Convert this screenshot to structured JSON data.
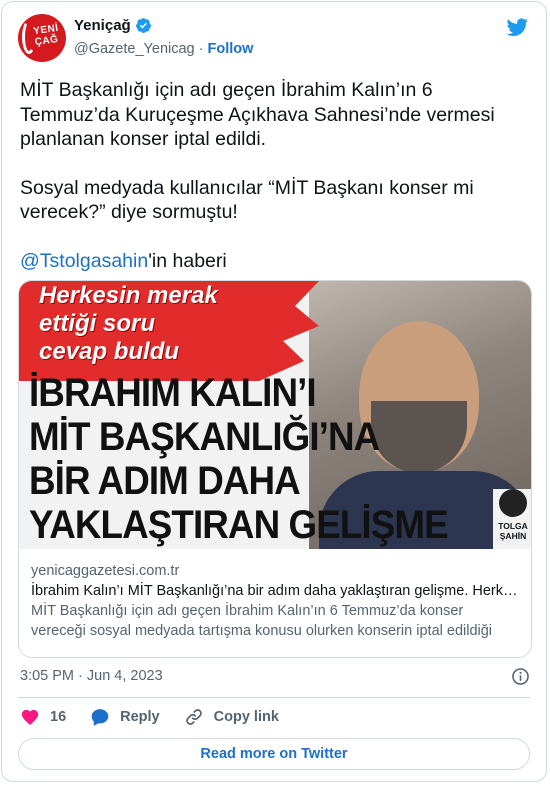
{
  "account": {
    "name": "Yeniçağ",
    "handle": "@Gazete_Yenicag",
    "separator": "·",
    "follow_label": "Follow",
    "avatar_text": "YENİ ÇAĞ"
  },
  "tweet": {
    "paragraph_1": "MİT Başkanlığı için adı geçen İbrahim Kalın’ın 6 Temmuz’da Kuruçeşme Açıkhava Sahnesi’nde vermesi planlanan konser iptal edildi.",
    "paragraph_2": "Sosyal medyada kullanıcılar “MİT Başkanı konser mi verecek?” diye sormuştu!",
    "mention": "@Tstolgasahin",
    "mention_suffix": "'in haberi"
  },
  "media": {
    "image_headline_small": [
      "Herkesin merak",
      "ettiği soru",
      "cevap buldu"
    ],
    "image_headline_big": [
      "İBRAHIM KALIN’I",
      "MİT BAŞKANLIĞI’NA",
      "BİR ADIM DAHA",
      "YAKLAŞTIRAN GELİŞME"
    ],
    "badge_name": [
      "TOLGA",
      "ŞAHİN"
    ],
    "link_domain": "yenicaggazetesi.com.tr",
    "link_title": "İbrahim Kalın’ı MİT Başkanlığı’na bir adım daha yaklaştıran gelişme. Herkesin merak ettiği soru cevap buldu",
    "link_description": "MİT Başkanlığı için adı geçen İbrahim Kalın’ın 6 Temmuz’da konser vereceği sosyal medyada tartışma konusu olurken konserin iptal edildiği ortaya çıktı."
  },
  "timestamp": "3:05 PM · Jun 4, 2023",
  "actions": {
    "like_count": "16",
    "reply_label": "Reply",
    "copy_label": "Copy link"
  },
  "read_more_label": "Read more on Twitter",
  "colors": {
    "brand_blue": "#1d9bf0",
    "link_blue": "#1d70c9",
    "like_red": "#f91880",
    "avatar_red": "#d41a1f"
  },
  "icons": {
    "verified": "verified-badge-icon",
    "platform": "twitter-bird-icon",
    "info": "info-icon",
    "like": "heart-icon",
    "reply": "reply-bubble-icon",
    "copy": "link-icon"
  }
}
